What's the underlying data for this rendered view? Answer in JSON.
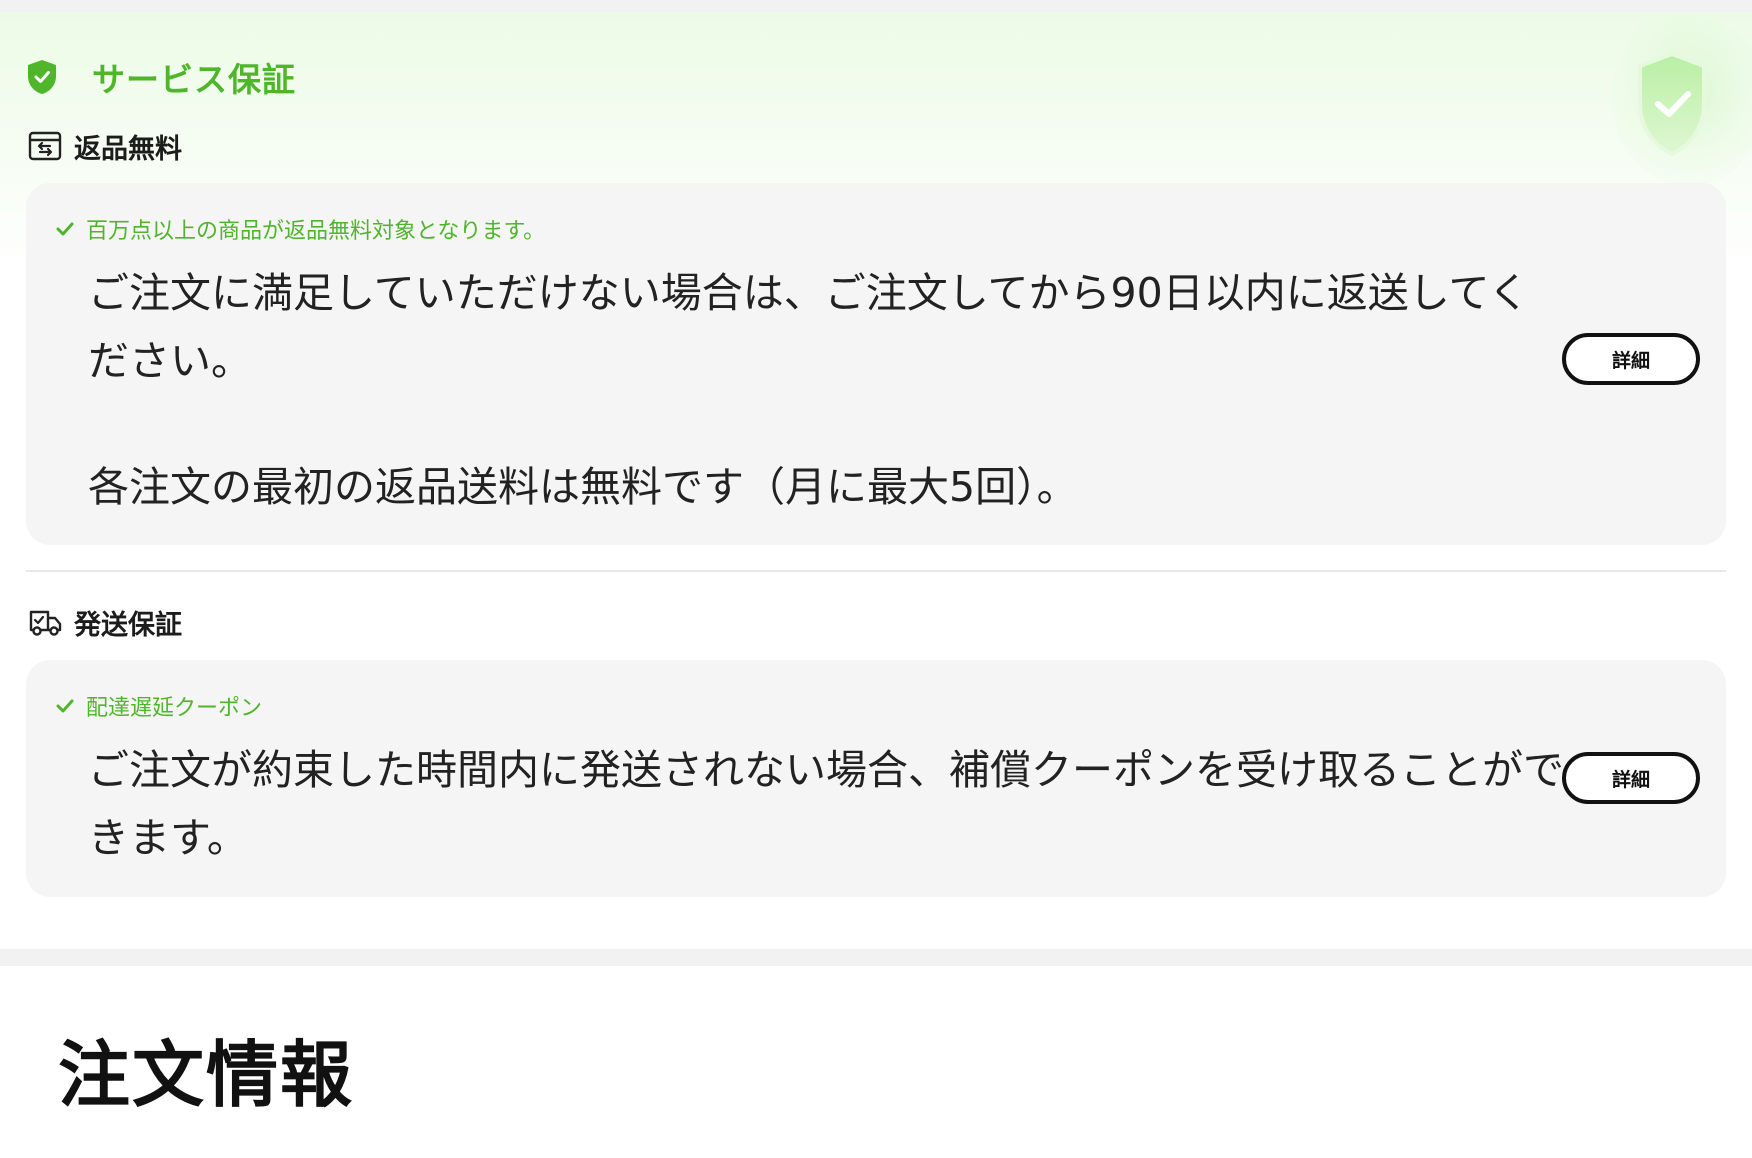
{
  "service": {
    "title": "サービス保証",
    "icon": "shield-check-icon",
    "accent_color": "#4fb52a"
  },
  "returns": {
    "heading": "返品無料",
    "icon": "return-box-icon",
    "feature": "百万点以上の商品が返品無料対象となります。",
    "description_1": "ご注文に満足していただけない場合は、ご注文してから90日以内に返送してください。",
    "description_2": "各注文の最初の返品送料は無料です（月に最大5回）。",
    "details_label": "詳細"
  },
  "shipping": {
    "heading": "発送保証",
    "icon": "delivery-truck-icon",
    "feature": "配達遅延クーポン",
    "description": "ご注文が約束した時間内に発送されない場合、補償クーポンを受け取ることができます。",
    "details_label": "詳細"
  },
  "order_info": {
    "title": "注文情報"
  }
}
